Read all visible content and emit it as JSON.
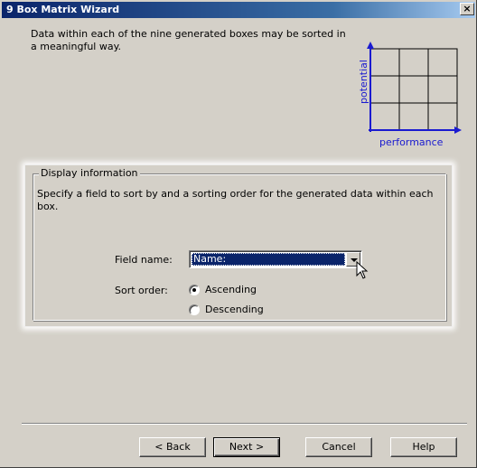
{
  "window": {
    "title": "9 Box Matrix Wizard",
    "close_glyph": "×"
  },
  "intro": {
    "text": "Data within each of the nine generated boxes may be sorted in a meaningful way."
  },
  "matrix_graphic": {
    "x_axis_label": "performance",
    "y_axis_label": "potential",
    "axis_color": "#1a1ad0",
    "grid_color": "#000000"
  },
  "display_info": {
    "group_title": "Display information",
    "description": "Specify a field to sort by and a sorting order for the generated data within each box.",
    "field_name_label": "Field name:",
    "field_name_value": "Name:",
    "sort_order_label": "Sort order:",
    "sort_options": [
      {
        "label": "Ascending",
        "selected": true
      },
      {
        "label": "Descending",
        "selected": false
      }
    ]
  },
  "buttons": {
    "back": "< Back",
    "next": "Next >",
    "cancel": "Cancel",
    "help": "Help"
  },
  "colors": {
    "dialog_face": "#d4d0c8",
    "title_bar": "#0a246a",
    "selection": "#0a246a"
  }
}
